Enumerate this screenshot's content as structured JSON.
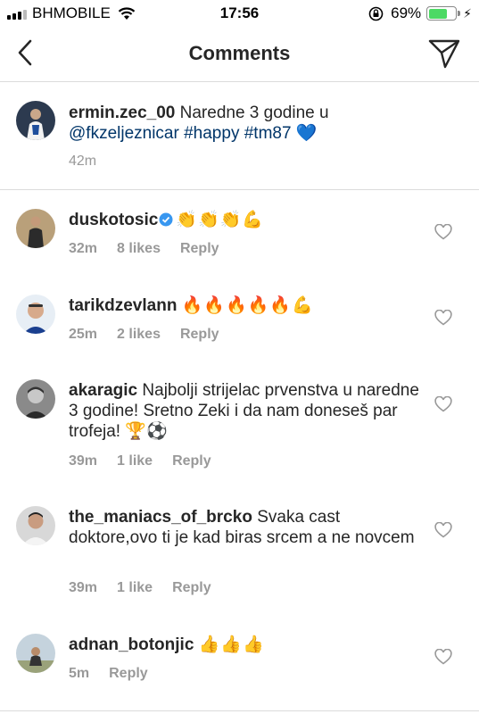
{
  "status_bar": {
    "carrier": "BHMOBILE",
    "time": "17:56",
    "battery": "69%",
    "battery_level": 0.69
  },
  "header": {
    "title": "Comments"
  },
  "caption": {
    "username": "ermin.zec_00",
    "text_before": " Naredne 3 godine u ",
    "mention": "@fkzeljeznicar",
    "tags": " #happy #tm87",
    "emoji": "💙",
    "time": "42m"
  },
  "comments": [
    {
      "username": "duskotosic",
      "verified": true,
      "text": "👏👏👏💪",
      "time": "32m",
      "likes": "8 likes",
      "reply": "Reply"
    },
    {
      "username": "tarikdzevlann",
      "text": "🔥🔥🔥🔥🔥💪",
      "time": "25m",
      "likes": "2 likes",
      "reply": "Reply"
    },
    {
      "username": "akaragic",
      "text": "Najbolji strijelac prvenstva u naredne 3 godine! Sretno Zeki i da nam doneseš par trofeja! 🏆⚽",
      "time": "39m",
      "likes": "1 like",
      "reply": "Reply"
    },
    {
      "username": "the_maniacs_of_brcko",
      "text": "Svaka cast doktore,ovo ti je kad biras srcem a ne novcem",
      "time": "39m",
      "likes": "1 like",
      "reply": "Reply"
    },
    {
      "username": "adnan_botonjic",
      "text": "👍👍👍",
      "time": "5m",
      "reply": "Reply"
    }
  ]
}
